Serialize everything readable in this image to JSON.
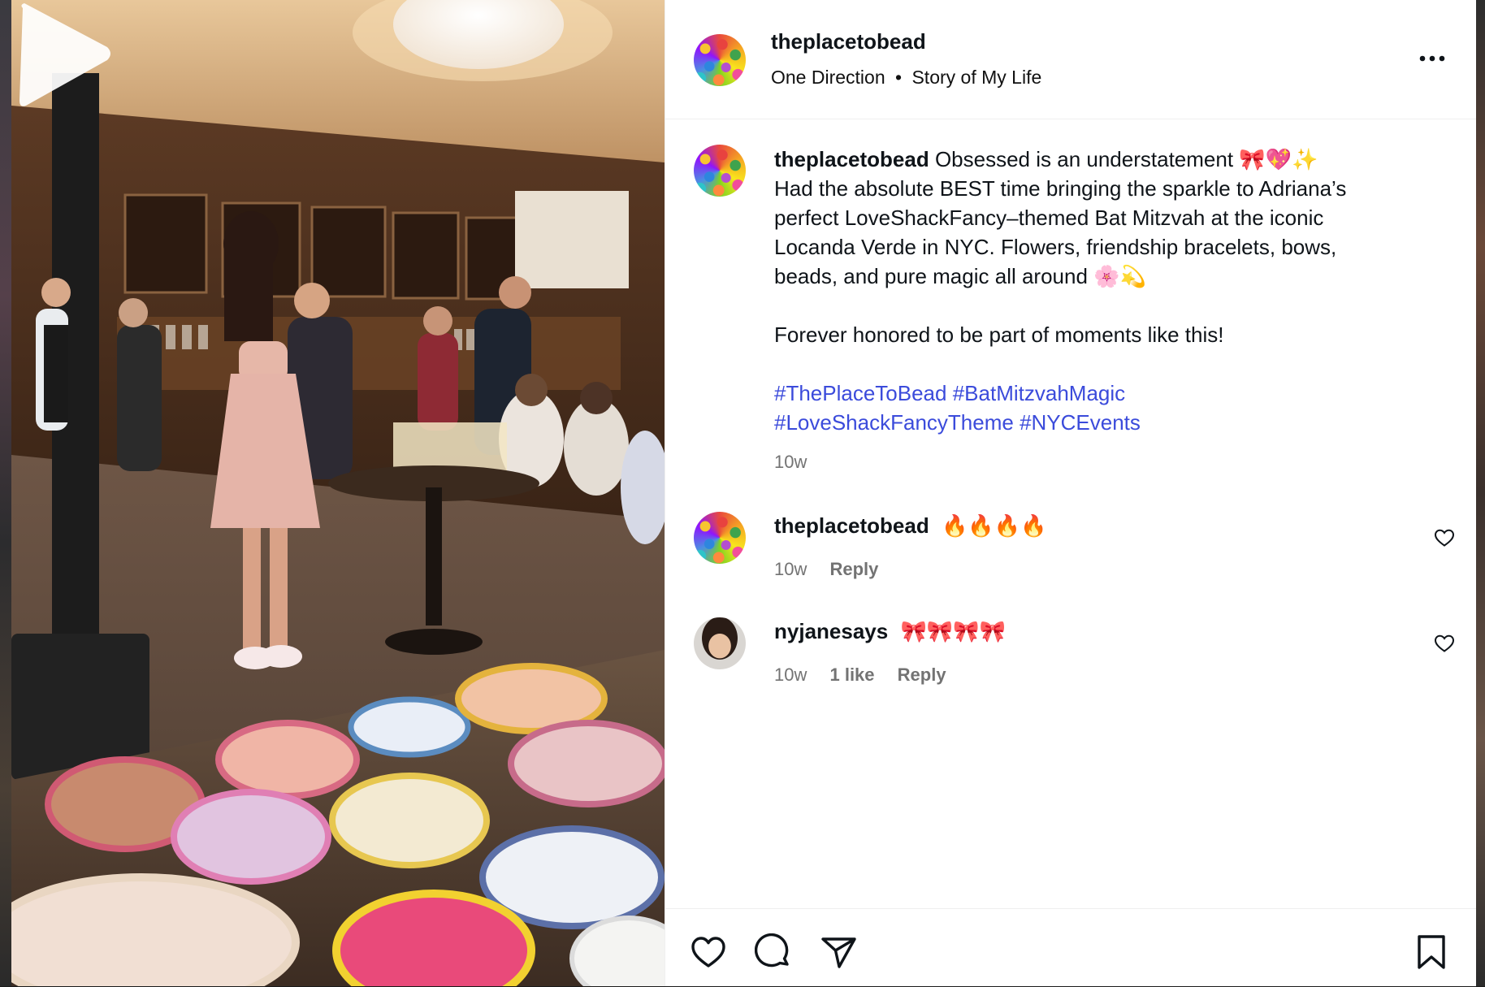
{
  "post": {
    "username": "theplacetobead",
    "audio": {
      "artist": "One Direction",
      "separator": "•",
      "track": "Story of My Life"
    }
  },
  "caption": {
    "username": "theplacetobead",
    "lines": [
      "Obsessed is an understatement 🎀💖✨",
      "Had the absolute BEST time bringing the sparkle to Adriana’s",
      "perfect LoveShackFancy–themed Bat Mitzvah at the iconic",
      "Locanda Verde in NYC. Flowers, friendship bracelets, bows,",
      "beads, and pure magic all around 🌸💫"
    ],
    "closing": "Forever honored to be part of moments like this!",
    "hashtags": [
      "#ThePlaceToBead",
      "#BatMitzvahMagic",
      "#LoveShackFancyTheme",
      "#NYCEvents"
    ],
    "time": "10w"
  },
  "comments": [
    {
      "username": "theplacetobead",
      "text": "🔥🔥🔥🔥",
      "time": "10w",
      "likes": "",
      "reply": "Reply"
    },
    {
      "username": "nyjanesays",
      "text": "🎀🎀🎀🎀",
      "time": "10w",
      "likes": "1 like",
      "reply": "Reply"
    }
  ],
  "icons": {
    "more": "more-horizontal-icon",
    "like": "heart-icon",
    "comment": "comment-bubble-icon",
    "share": "paper-plane-icon",
    "save": "bookmark-icon",
    "play": "play-icon"
  },
  "colors": {
    "hashtag": "#3b4bdb",
    "muted": "#737373",
    "text": "#0f1419"
  }
}
